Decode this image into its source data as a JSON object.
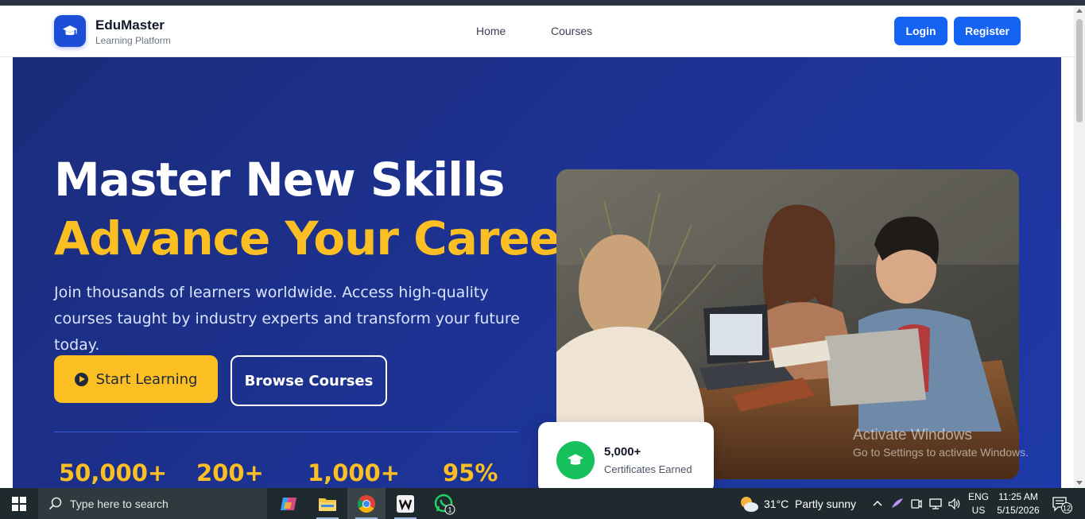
{
  "header": {
    "brand_name": "EduMaster",
    "brand_subtitle": "Learning Platform",
    "nav": [
      {
        "label": "Home"
      },
      {
        "label": "Courses"
      }
    ],
    "login_label": "Login",
    "register_label": "Register"
  },
  "hero": {
    "title_line1": "Master New Skills",
    "title_line2": "Advance Your Career",
    "description": "Join thousands of learners worldwide. Access high-quality courses taught by industry experts and transform your future today.",
    "start_label": "Start Learning",
    "browse_label": "Browse Courses",
    "stats": [
      {
        "value": "50,000+"
      },
      {
        "value": "200+"
      },
      {
        "value": "1,000+"
      },
      {
        "value": "95%"
      }
    ],
    "cert_card": {
      "count": "5,000+",
      "label": "Certificates Earned"
    }
  },
  "watermark": {
    "title": "Activate Windows",
    "subtitle": "Go to Settings to activate Windows."
  },
  "taskbar": {
    "search_placeholder": "Type here to search",
    "weather_temp": "31°C",
    "weather_desc": "Partly sunny",
    "lang_line1": "ENG",
    "lang_line2": "US",
    "time": "11:25 AM",
    "date": "5/15/2026",
    "whatsapp_badge": "1",
    "notification_count": "12"
  },
  "colors": {
    "primary": "#1463f3",
    "hero_bg": "#1d3291",
    "accent_yellow": "#fbbf24",
    "success_green": "#16c15b"
  }
}
